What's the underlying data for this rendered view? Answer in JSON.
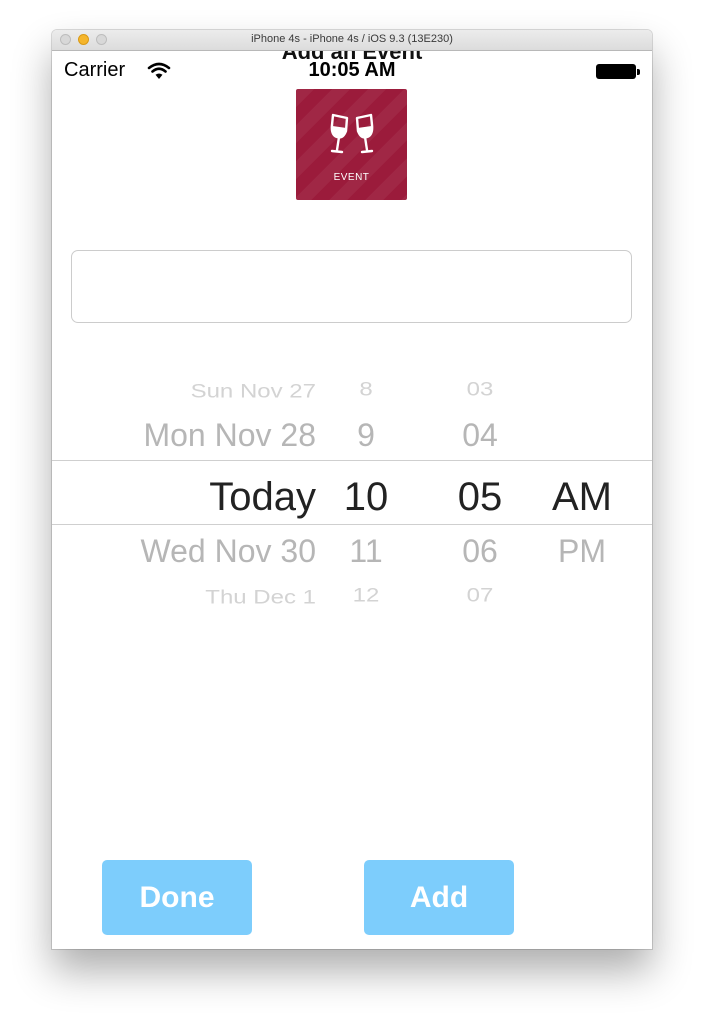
{
  "window": {
    "title": "iPhone 4s - iPhone 4s / iOS 9.3 (13E230)"
  },
  "nav": {
    "title": "Add an Event"
  },
  "status_bar": {
    "carrier": "Carrier",
    "time": "10:05 AM",
    "icons": [
      "wifi-icon",
      "battery-icon"
    ]
  },
  "event_tile": {
    "label": "EVENT",
    "icon": "wine-glasses-icon",
    "color": "#9b1b3b"
  },
  "text_field": {
    "value": "",
    "placeholder": ""
  },
  "date_picker": {
    "date_column": [
      "Sun Nov 27",
      "Mon Nov 28",
      "Today",
      "Wed Nov 30",
      "Thu Dec 1"
    ],
    "hour_column": [
      "8",
      "9",
      "10",
      "11",
      "12"
    ],
    "minute_column": [
      "03",
      "04",
      "05",
      "06",
      "07"
    ],
    "ampm_column": [
      "AM",
      "PM"
    ],
    "selected": {
      "date": "Today",
      "hour": "10",
      "minute": "05",
      "ampm": "AM"
    }
  },
  "buttons": {
    "done_label": "Done",
    "add_label": "Add",
    "color": "#7dcdfc"
  }
}
